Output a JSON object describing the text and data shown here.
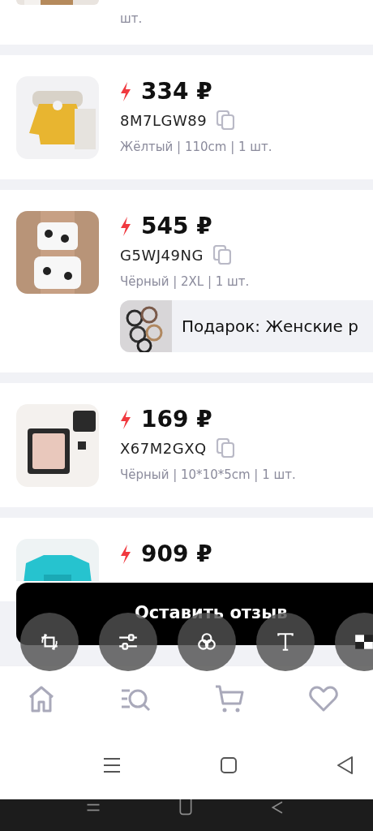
{
  "previous_item": {
    "details_tail": "шт."
  },
  "items": [
    {
      "price": "334 ₽",
      "code": "8M7LGW89",
      "details": "Жёлтый | 110cm | 1 шт."
    },
    {
      "price": "545 ₽",
      "code": "G5WJ49NG",
      "details": "Чёрный | 2XL | 1 шт.",
      "gift": {
        "label": "Подарок: Женские р"
      }
    },
    {
      "price": "169 ₽",
      "code": "X67M2GXQ",
      "details": "Чёрный | 10*10*5cm | 1 шт."
    },
    {
      "price": "909 ₽"
    }
  ],
  "review_button": {
    "label": "Оставить отзыв"
  },
  "edit_tools": [
    {
      "kind": "crop"
    },
    {
      "kind": "adjust"
    },
    {
      "kind": "filter"
    },
    {
      "kind": "text"
    },
    {
      "kind": "mosaic"
    }
  ],
  "bottom_nav": [
    {
      "kind": "home"
    },
    {
      "kind": "catalog"
    },
    {
      "kind": "cart"
    },
    {
      "kind": "favorites"
    }
  ],
  "system_nav": [
    {
      "kind": "menu"
    },
    {
      "kind": "home"
    },
    {
      "kind": "back"
    }
  ]
}
